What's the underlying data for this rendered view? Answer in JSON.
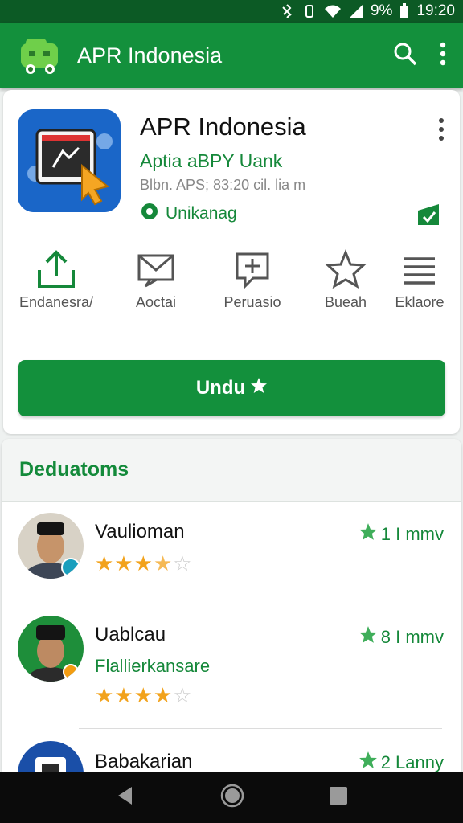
{
  "status_bar": {
    "battery_text": "9%",
    "time": "19:20"
  },
  "app_bar": {
    "title": "APR Indonesia"
  },
  "app": {
    "name": "APR Indonesia",
    "developer": "Aptia aBPY Uank",
    "meta": "Blbn. APS; 83:20 cil. lia m",
    "badge": "Unikanag"
  },
  "actions": [
    {
      "label": "Endanesra/",
      "icon": "share-up-icon"
    },
    {
      "label": "Aoctai",
      "icon": "mail-icon"
    },
    {
      "label": "Peruasio",
      "icon": "chat-plus-icon"
    },
    {
      "label": "Bueah",
      "icon": "star-outline-icon"
    },
    {
      "label": "Eklaore",
      "icon": "list-icon"
    }
  ],
  "install_button": {
    "label": "Undu"
  },
  "reviews_section": {
    "title": "Deduatoms",
    "items": [
      {
        "name": "Vaulioman",
        "subtitle": "",
        "score": "1 I mmv",
        "rating": 3.5
      },
      {
        "name": "Uablcau",
        "subtitle": "Flallierkansare",
        "score": "8 I mmv",
        "rating": 4
      },
      {
        "name": "Babakarian",
        "subtitle": "",
        "score": "2 Lanny",
        "rating": null
      }
    ]
  },
  "colors": {
    "primary": "#13903c",
    "status_bar": "#0c5a25",
    "star": "#f2a21b",
    "app_icon_bg": "#1a66c8"
  }
}
